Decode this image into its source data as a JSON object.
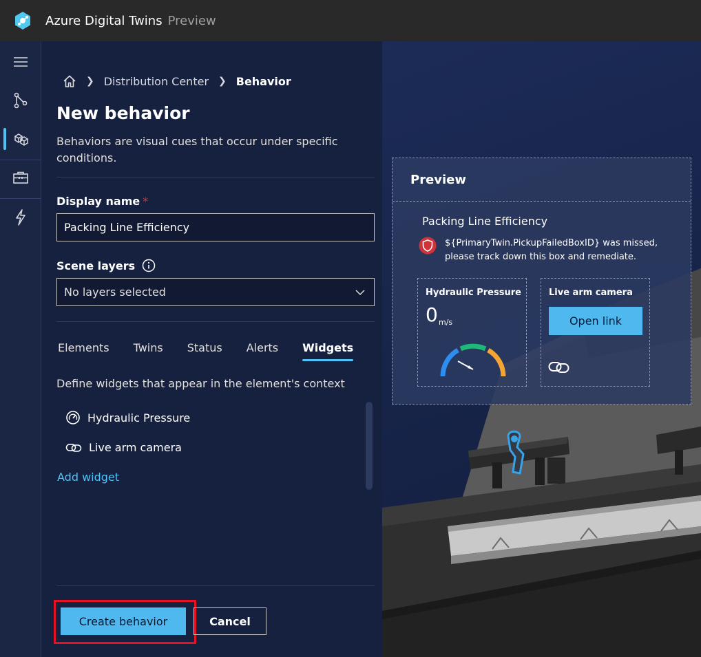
{
  "app": {
    "title": "Azure Digital Twins",
    "tag": "Preview"
  },
  "breadcrumb": {
    "items": [
      "Distribution Center",
      "Behavior"
    ]
  },
  "page": {
    "title": "New behavior",
    "description": "Behaviors are visual cues that occur under specific conditions."
  },
  "form": {
    "display_name_label": "Display name",
    "required_mark": "*",
    "display_name_value": "Packing Line Efficiency",
    "scene_layers_label": "Scene layers",
    "scene_layers_value": "No layers selected"
  },
  "tabs": [
    {
      "label": "Elements"
    },
    {
      "label": "Twins"
    },
    {
      "label": "Status"
    },
    {
      "label": "Alerts"
    },
    {
      "label": "Widgets",
      "active": true
    }
  ],
  "widgets_section": {
    "description": "Define widgets that appear in the element's context",
    "items": [
      {
        "label": "Hydraulic Pressure",
        "icon": "gauge-icon"
      },
      {
        "label": "Live arm camera",
        "icon": "link-icon"
      }
    ],
    "add_label": "Add widget"
  },
  "actions": {
    "create_label": "Create behavior",
    "cancel_label": "Cancel"
  },
  "preview": {
    "header": "Preview",
    "title": "Packing Line Efficiency",
    "alert_text": "${PrimaryTwin.PickupFailedBoxID} was missed, please track down this box and remediate.",
    "gauge": {
      "title": "Hydraulic Pressure",
      "value": "0",
      "unit": "m/s"
    },
    "link_widget": {
      "title": "Live arm camera",
      "button": "Open link"
    }
  },
  "colors": {
    "accent": "#4fc3f7",
    "primary_button": "#4fb9ef",
    "highlight": "#e81123",
    "alert": "#d13438"
  }
}
